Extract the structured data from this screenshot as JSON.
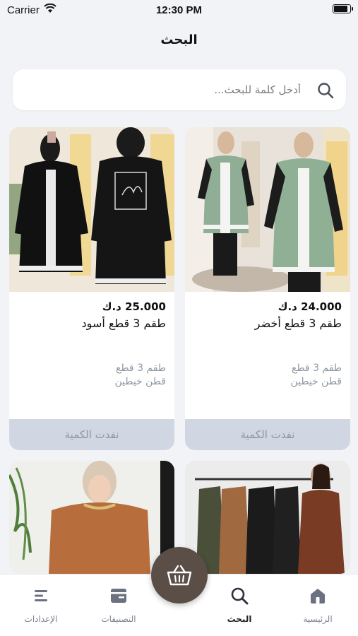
{
  "status_bar": {
    "carrier": "Carrier",
    "time": "12:30 PM",
    "battery_level": 0.9
  },
  "header": {
    "title": "البحث"
  },
  "search": {
    "placeholder": "أدخل كلمة للبحث..."
  },
  "products": [
    {
      "price": "24.000 د.ك",
      "name": "طقم 3 قطع أخضر",
      "desc_line1": "طقم 3 قطع",
      "desc_line2": "قطن خيطين",
      "button": "نفدت الكمية"
    },
    {
      "price": "25.000 د.ك",
      "name": "طقم 3 قطع أسود",
      "desc_line1": "طقم 3 قطع",
      "desc_line2": "قطن خيطين",
      "button": "نفدت الكمية"
    }
  ],
  "tabs": [
    {
      "label": "الرئيسية",
      "icon": "home-icon"
    },
    {
      "label": "البحث",
      "icon": "search-icon",
      "active": true
    },
    {
      "label": "التصنيفات",
      "icon": "categories-icon"
    },
    {
      "label": "الإعدادات",
      "icon": "settings-icon"
    }
  ],
  "cart": {
    "icon": "basket-icon"
  }
}
